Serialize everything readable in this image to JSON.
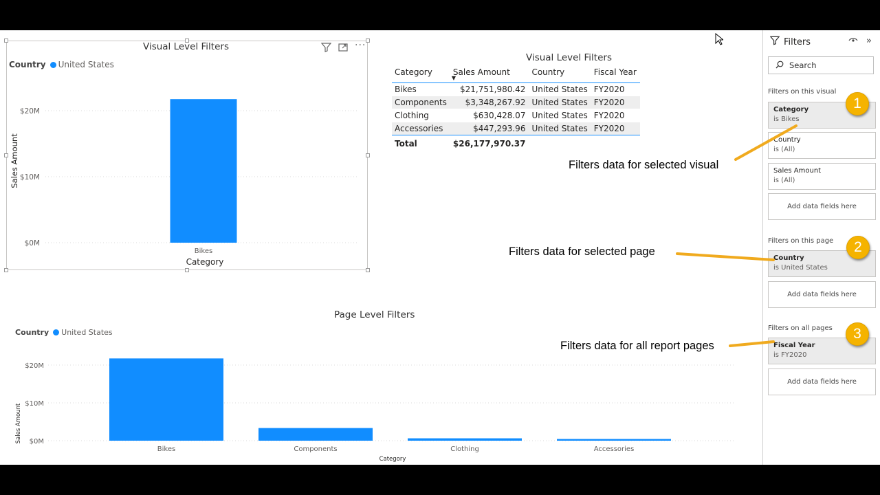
{
  "visual1": {
    "title": "Visual Level Filters",
    "legend_title": "Country",
    "legend_item": "United States",
    "icons": [
      "filter-icon",
      "focus-mode-icon",
      "more-options-icon"
    ]
  },
  "table": {
    "title": "Visual Level Filters",
    "headers": [
      "Category",
      "Sales Amount",
      "Country",
      "Fiscal Year"
    ],
    "rows": [
      [
        "Bikes",
        "$21,751,980.42",
        "United States",
        "FY2020"
      ],
      [
        "Components",
        "$3,348,267.92",
        "United States",
        "FY2020"
      ],
      [
        "Clothing",
        "$630,428.07",
        "United States",
        "FY2020"
      ],
      [
        "Accessories",
        "$447,293.96",
        "United States",
        "FY2020"
      ]
    ],
    "total_label": "Total",
    "total_value": "$26,177,970.37"
  },
  "visual2": {
    "title": "Page Level Filters",
    "legend_title": "Country",
    "legend_item": "United States"
  },
  "callouts": {
    "visual": "Filters data for selected visual",
    "page": "Filters data for selected page",
    "all": "Filters data for all report pages"
  },
  "filters": {
    "title": "Filters",
    "search_placeholder": "Search",
    "sections": {
      "visual": "Filters on this visual",
      "page": "Filters on this page",
      "all": "Filters on all pages"
    },
    "visual_cards": [
      {
        "name": "Category",
        "value": "is Bikes"
      },
      {
        "name": "Country",
        "value": "is (All)"
      },
      {
        "name": "Sales Amount",
        "value": "is (All)"
      }
    ],
    "page_cards": [
      {
        "name": "Country",
        "value": "is United States"
      }
    ],
    "all_cards": [
      {
        "name": "Fiscal Year",
        "value": "is FY2020"
      }
    ],
    "add_label": "Add data fields here",
    "badges": [
      "1",
      "2",
      "3"
    ]
  },
  "colors": {
    "bar": "#118DFF",
    "badge": "#F5B300",
    "arrow": "#F0AA1E"
  },
  "chart_data": [
    {
      "type": "bar",
      "title": "Visual Level Filters",
      "categories": [
        "Bikes"
      ],
      "values": [
        21751980.42
      ],
      "xlabel": "Category",
      "ylabel": "Sales Amount",
      "ylim": [
        0,
        20000000
      ],
      "yticks": [
        "$0M",
        "$10M",
        "$20M"
      ],
      "grid": true,
      "legend": "top-left"
    },
    {
      "type": "bar",
      "title": "Page Level Filters",
      "categories": [
        "Bikes",
        "Components",
        "Clothing",
        "Accessories"
      ],
      "values": [
        21751980.42,
        3348267.92,
        630428.07,
        447293.96
      ],
      "xlabel": "Category",
      "ylabel": "Sales Amount",
      "ylim": [
        0,
        20000000
      ],
      "yticks": [
        "$0M",
        "$10M",
        "$20M"
      ],
      "grid": true,
      "legend": "top-left"
    }
  ]
}
